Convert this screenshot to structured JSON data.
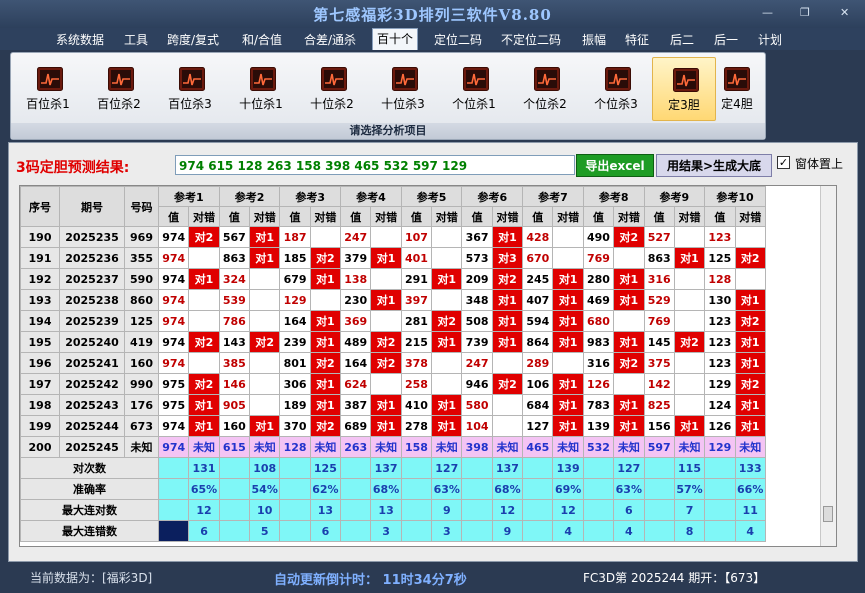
{
  "window": {
    "title": "第七感福彩3D排列三软件V8.80",
    "minimize": "—",
    "maximize": "❐",
    "close": "✕"
  },
  "menu": [
    "系统数据",
    "工具",
    "跨度/复式",
    "和/合值",
    "合差/通杀",
    "百十个",
    "定位二码",
    "不定位二码",
    "振幅",
    "特征",
    "后二",
    "后一",
    "计划"
  ],
  "menu_active_index": 5,
  "ribbon": {
    "buttons": [
      "百位杀1",
      "百位杀2",
      "百位杀3",
      "十位杀1",
      "十位杀2",
      "十位杀3",
      "个位杀1",
      "个位杀2",
      "个位杀3",
      "定3胆",
      "定4胆"
    ],
    "active_index": 9,
    "footer": "请选择分析项目",
    "icon": "chart-icon"
  },
  "prediction": {
    "label": "3码定胆预测结果:",
    "value": "974 615 128 263 158 398 465 532 597 129",
    "export_button": "导出excel",
    "generate_button": "用结果>生成大底",
    "checkbox_label": "窗体置上",
    "checkbox_checked": true
  },
  "table": {
    "headers": {
      "idx": "序号",
      "period": "期号",
      "code": "号码",
      "ref": [
        "参考1",
        "参考2",
        "参考3",
        "参考4",
        "参考5",
        "参考6",
        "参考7",
        "参考8",
        "参考9",
        "参考10"
      ],
      "sub_value": "值",
      "sub_mark": "对错"
    },
    "rows": [
      {
        "idx": "190",
        "period": "2025235",
        "code": "969",
        "cells": [
          [
            "974",
            "对2"
          ],
          [
            "567",
            "对1"
          ],
          [
            "187",
            ""
          ],
          [
            "247",
            ""
          ],
          [
            "107",
            ""
          ],
          [
            "367",
            "对1"
          ],
          [
            "428",
            ""
          ],
          [
            "490",
            "对2"
          ],
          [
            "527",
            ""
          ],
          [
            "123",
            ""
          ]
        ]
      },
      {
        "idx": "191",
        "period": "2025236",
        "code": "355",
        "cells": [
          [
            "974",
            ""
          ],
          [
            "863",
            "对1"
          ],
          [
            "185",
            "对2"
          ],
          [
            "379",
            "对1"
          ],
          [
            "401",
            ""
          ],
          [
            "573",
            "对3"
          ],
          [
            "670",
            ""
          ],
          [
            "769",
            ""
          ],
          [
            "863",
            "对1"
          ],
          [
            "125",
            "对2"
          ]
        ]
      },
      {
        "idx": "192",
        "period": "2025237",
        "code": "590",
        "cells": [
          [
            "974",
            "对1"
          ],
          [
            "324",
            ""
          ],
          [
            "679",
            "对1"
          ],
          [
            "138",
            ""
          ],
          [
            "291",
            "对1"
          ],
          [
            "209",
            "对2"
          ],
          [
            "245",
            "对1"
          ],
          [
            "280",
            "对1"
          ],
          [
            "316",
            ""
          ],
          [
            "128",
            ""
          ]
        ]
      },
      {
        "idx": "193",
        "period": "2025238",
        "code": "860",
        "cells": [
          [
            "974",
            ""
          ],
          [
            "539",
            ""
          ],
          [
            "129",
            ""
          ],
          [
            "230",
            "对1"
          ],
          [
            "397",
            ""
          ],
          [
            "348",
            "对1"
          ],
          [
            "407",
            "对1"
          ],
          [
            "469",
            "对1"
          ],
          [
            "529",
            ""
          ],
          [
            "130",
            "对1"
          ]
        ]
      },
      {
        "idx": "194",
        "period": "2025239",
        "code": "125",
        "cells": [
          [
            "974",
            ""
          ],
          [
            "786",
            ""
          ],
          [
            "164",
            "对1"
          ],
          [
            "369",
            ""
          ],
          [
            "281",
            "对2"
          ],
          [
            "508",
            "对1"
          ],
          [
            "594",
            "对1"
          ],
          [
            "680",
            ""
          ],
          [
            "769",
            ""
          ],
          [
            "123",
            "对2"
          ]
        ]
      },
      {
        "idx": "195",
        "period": "2025240",
        "code": "419",
        "cells": [
          [
            "974",
            "对2"
          ],
          [
            "143",
            "对2"
          ],
          [
            "239",
            "对1"
          ],
          [
            "489",
            "对2"
          ],
          [
            "215",
            "对1"
          ],
          [
            "739",
            "对1"
          ],
          [
            "864",
            "对1"
          ],
          [
            "983",
            "对1"
          ],
          [
            "145",
            "对2"
          ],
          [
            "123",
            "对1"
          ]
        ]
      },
      {
        "idx": "196",
        "period": "2025241",
        "code": "160",
        "cells": [
          [
            "974",
            ""
          ],
          [
            "385",
            ""
          ],
          [
            "801",
            "对2"
          ],
          [
            "164",
            "对2"
          ],
          [
            "378",
            ""
          ],
          [
            "247",
            ""
          ],
          [
            "289",
            ""
          ],
          [
            "316",
            "对2"
          ],
          [
            "375",
            ""
          ],
          [
            "123",
            "对1"
          ]
        ]
      },
      {
        "idx": "197",
        "period": "2025242",
        "code": "990",
        "cells": [
          [
            "975",
            "对2"
          ],
          [
            "146",
            ""
          ],
          [
            "306",
            "对1"
          ],
          [
            "624",
            ""
          ],
          [
            "258",
            ""
          ],
          [
            "946",
            "对2"
          ],
          [
            "106",
            "对1"
          ],
          [
            "126",
            ""
          ],
          [
            "142",
            ""
          ],
          [
            "129",
            "对2"
          ]
        ]
      },
      {
        "idx": "198",
        "period": "2025243",
        "code": "176",
        "cells": [
          [
            "975",
            "对1"
          ],
          [
            "905",
            ""
          ],
          [
            "189",
            "对1"
          ],
          [
            "387",
            "对1"
          ],
          [
            "410",
            "对1"
          ],
          [
            "580",
            ""
          ],
          [
            "684",
            "对1"
          ],
          [
            "783",
            "对1"
          ],
          [
            "825",
            ""
          ],
          [
            "124",
            "对1"
          ]
        ]
      },
      {
        "idx": "199",
        "period": "2025244",
        "code": "673",
        "cells": [
          [
            "974",
            "对1"
          ],
          [
            "160",
            "对1"
          ],
          [
            "370",
            "对2"
          ],
          [
            "689",
            "对1"
          ],
          [
            "278",
            "对1"
          ],
          [
            "104",
            ""
          ],
          [
            "127",
            "对1"
          ],
          [
            "139",
            "对1"
          ],
          [
            "156",
            "对1"
          ],
          [
            "126",
            "对1"
          ]
        ]
      }
    ],
    "prediction_row": {
      "idx": "200",
      "period": "2025245",
      "code": "未知",
      "values": [
        "974",
        "615",
        "128",
        "263",
        "158",
        "398",
        "465",
        "532",
        "597",
        "129"
      ],
      "mark": "未知"
    },
    "stats": [
      {
        "label": "对次数",
        "values": [
          "131",
          "108",
          "125",
          "137",
          "127",
          "137",
          "139",
          "127",
          "115",
          "133"
        ]
      },
      {
        "label": "准确率",
        "values": [
          "65%",
          "54%",
          "62%",
          "68%",
          "63%",
          "68%",
          "69%",
          "63%",
          "57%",
          "66%"
        ]
      },
      {
        "label": "最大连对数",
        "values": [
          "12",
          "10",
          "13",
          "13",
          "9",
          "12",
          "12",
          "6",
          "7",
          "11"
        ]
      },
      {
        "label": "最大连错数",
        "values": [
          "6",
          "5",
          "6",
          "3",
          "3",
          "9",
          "4",
          "4",
          "8",
          "4"
        ]
      }
    ]
  },
  "status": {
    "source": "当前数据为：[福彩3D]",
    "countdown": "自动更新倒计时：  11时34分7秒",
    "latest": "FC3D第 2025244 期开：【673】"
  },
  "colors": {
    "hit": "#e00000",
    "prediction_row": "#f4c4f4",
    "stats_bg": "#7ff7f7",
    "export": "#1e9c24"
  }
}
